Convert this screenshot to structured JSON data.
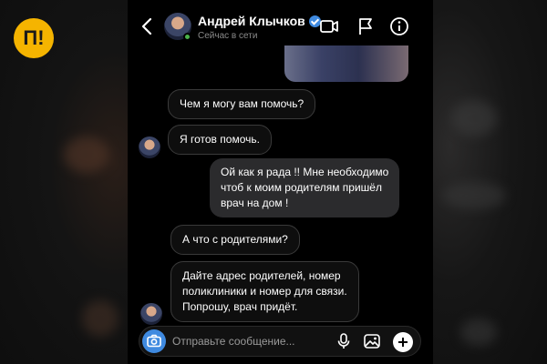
{
  "logo": {
    "text": "П!"
  },
  "header": {
    "contact_name": "Андрей Клычков",
    "status": "Сейчас в сети",
    "icons": [
      "back-icon",
      "video-call-icon",
      "flag-icon",
      "info-icon"
    ]
  },
  "messages": [
    {
      "direction": "in",
      "text": "Чем я могу вам помочь?"
    },
    {
      "direction": "in",
      "text": "Я готов помочь."
    },
    {
      "direction": "out",
      "lines": [
        "Ой как я рада !! Мне необходимо",
        "чтоб к моим родителям пришёл",
        "врач на дом !"
      ]
    },
    {
      "direction": "in",
      "text": "А что с родителями?"
    },
    {
      "direction": "in",
      "lines": [
        "Дайте адрес родителей, номер",
        "поликлиники и номер для связи.",
        "Попрошу, врач придёт."
      ]
    }
  ],
  "composer": {
    "placeholder": "Отправьте сообщение...",
    "icons": [
      "camera-icon",
      "microphone-icon",
      "gallery-icon",
      "plus-icon"
    ]
  },
  "colors": {
    "accent": "#3f8ae0",
    "logo": "#f5b400",
    "online": "#4bb34b"
  }
}
